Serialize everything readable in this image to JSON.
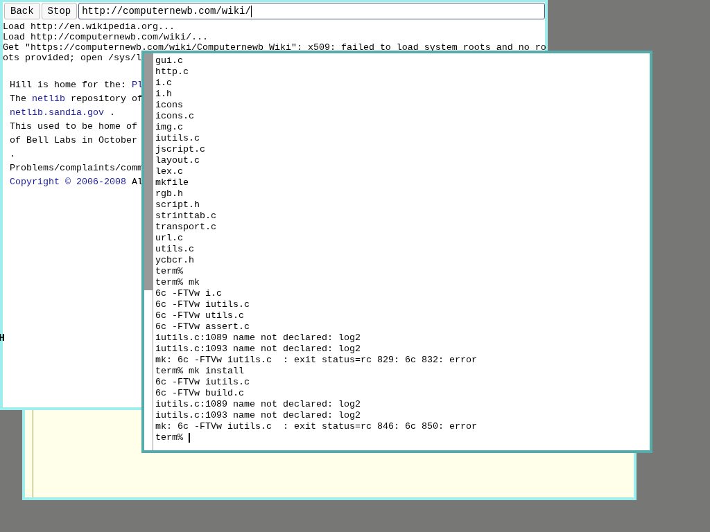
{
  "browser": {
    "buttons": [
      "Back",
      "Stop"
    ],
    "url": "http://computernewb.com/wiki/",
    "log": [
      "Load http://en.wikipedia.org...",
      "Load http://computernewb.com/wiki/...",
      "Get \"https://computernewb.com/wiki/Computernewb Wiki\": x509: failed to load system roots and no ro",
      "ots provided; open /sys/l"
    ],
    "page": [
      [
        {
          "text": "Hill is home for the: ",
          "link": false
        },
        {
          "text": "Pl",
          "link": true
        }
      ],
      [
        {
          "text": "The ",
          "link": false
        },
        {
          "text": "netlib",
          "link": true
        },
        {
          "text": " repository of",
          "link": false
        }
      ],
      [
        {
          "text": "netlib.sandia.gov",
          "link": true
        },
        {
          "text": " .",
          "link": false
        }
      ],
      [
        {
          "text": "This used to be home of",
          "link": false
        }
      ],
      [
        {
          "text": "of Bell Labs in October",
          "link": false
        }
      ],
      [
        {
          "text": ".",
          "link": false
        }
      ],
      [
        {
          "text": "Problems/complaints/comm",
          "link": false
        }
      ],
      [
        {
          "text": "Copyright © 2006-2008",
          "link": true
        },
        {
          "text": " Al",
          "link": false
        }
      ]
    ]
  },
  "stray_text": "H",
  "terminal": {
    "lines": [
      "gui.c",
      "http.c",
      "i.c",
      "i.h",
      "icons",
      "icons.c",
      "img.c",
      "iutils.c",
      "jscript.c",
      "layout.c",
      "lex.c",
      "mkfile",
      "rgb.h",
      "script.h",
      "strinttab.c",
      "transport.c",
      "url.c",
      "utils.c",
      "ycbcr.h",
      "term%",
      "term% mk",
      "6c -FTVw i.c",
      "6c -FTVw iutils.c",
      "6c -FTVw utils.c",
      "6c -FTVw assert.c",
      "iutils.c:1089 name not declared: log2",
      "iutils.c:1093 name not declared: log2",
      "mk: 6c -FTVw iutils.c  : exit status=rc 829: 6c 832: error",
      "term% mk install",
      "6c -FTVw iutils.c",
      "6c -FTVw build.c",
      "iutils.c:1089 name not declared: log2",
      "iutils.c:1093 name not declared: log2",
      "mk: 6c -FTVw iutils.c  : exit status=rc 846: 6c 850: error",
      "term% "
    ]
  }
}
